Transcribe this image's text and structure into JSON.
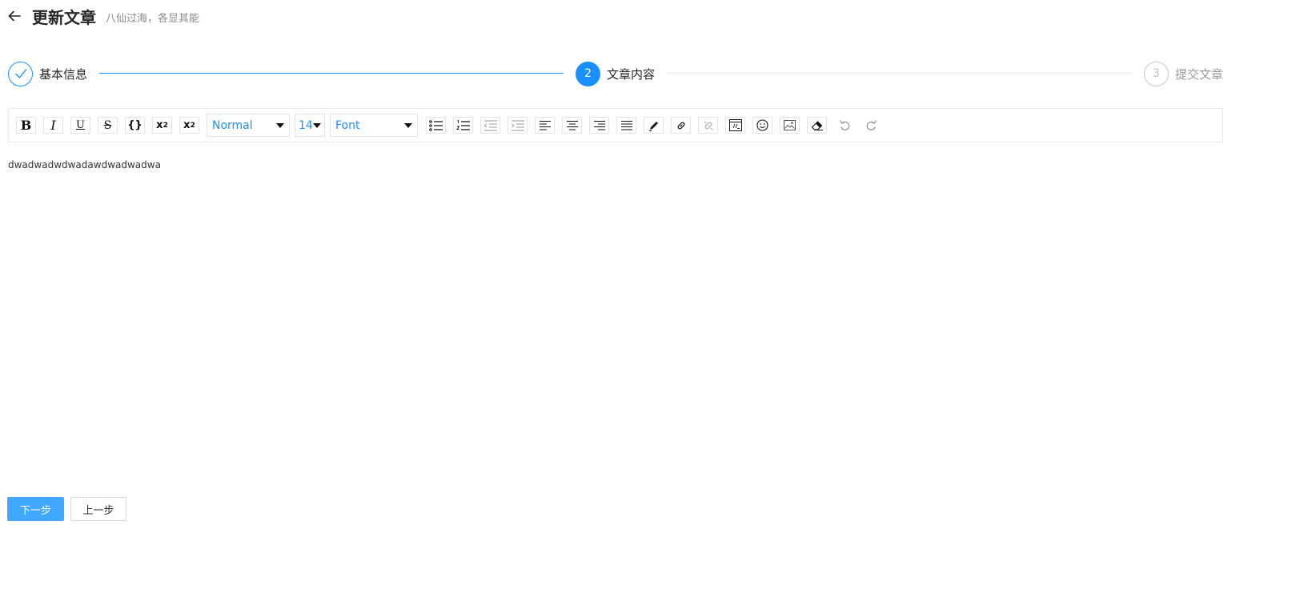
{
  "header": {
    "title": "更新文章",
    "subtitle": "八仙过海，各显其能"
  },
  "steps": [
    {
      "label": "基本信息",
      "status": "finish",
      "icon": "check-icon"
    },
    {
      "label": "文章内容",
      "number": "2",
      "status": "process"
    },
    {
      "label": "提交文章",
      "number": "3",
      "status": "wait"
    }
  ],
  "toolbar": {
    "bold": "B",
    "italic": "I",
    "underline": "U",
    "strike": "S",
    "code": "{}",
    "superscript_base": "x",
    "superscript_exp": "2",
    "subscript_base": "x",
    "subscript_exp": "2",
    "heading_value": "Normal",
    "size_value": "14",
    "font_value": "Font"
  },
  "editor": {
    "content": "dwadwadwdwadawdwadwadwa"
  },
  "buttons": {
    "next": "下一步",
    "prev": "上一步"
  },
  "colors": {
    "primary": "#1890ff",
    "button_primary": "#40a9ff"
  }
}
